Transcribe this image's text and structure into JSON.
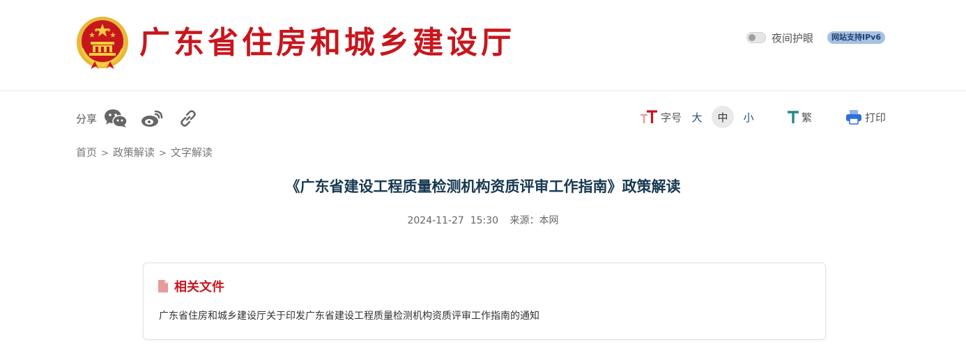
{
  "header": {
    "site_title": "广东省住房和城乡建设厅",
    "night_mode_label": "夜间护眼",
    "night_mode_on": false,
    "ipv6_badge": "网站支持IPv6"
  },
  "toolbar": {
    "share_label": "分享",
    "share_icons": [
      "wechat-icon",
      "weibo-icon",
      "link-icon"
    ],
    "font_size_label": "字号",
    "font_sizes": [
      "大",
      "中",
      "小"
    ],
    "font_size_selected": "中",
    "traditional_label": "繁",
    "print_label": "打印"
  },
  "breadcrumb": {
    "items": [
      "首页",
      "政策解读",
      "文字解读"
    ],
    "separator": ">"
  },
  "article": {
    "title": "《广东省建设工程质量检测机构资质评审工作指南》政策解读",
    "date": "2024-11-27  15:30",
    "source": "来源：本网"
  },
  "related": {
    "heading": "相关文件",
    "links": [
      "广东省住房和城乡建设厅关于印发广东省建设工程质量检测机构资质评审工作指南的通知"
    ]
  },
  "colors": {
    "brand_red": "#c8161d",
    "title_navy": "#16384f",
    "ipv6_bg": "#a7c1e3"
  }
}
